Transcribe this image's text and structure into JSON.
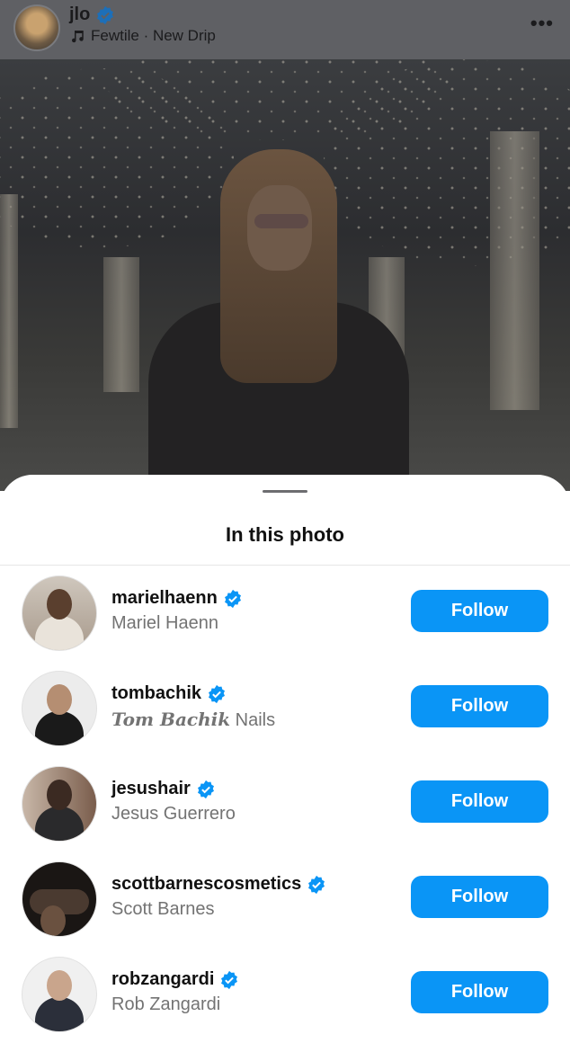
{
  "post": {
    "username": "jlo",
    "music": "Fewtile · New Drip",
    "more_label": "•••"
  },
  "sheet": {
    "title": "In this photo"
  },
  "people": [
    {
      "username": "marielhaenn",
      "name": "Mariel Haenn",
      "name_styled": "",
      "follow_label": "Follow"
    },
    {
      "username": "tombachik",
      "name": "Nails",
      "name_styled": "Tom Bachik",
      "follow_label": "Follow"
    },
    {
      "username": "jesushair",
      "name": "Jesus Guerrero",
      "name_styled": "",
      "follow_label": "Follow"
    },
    {
      "username": "scottbarnescosmetics",
      "name": "Scott Barnes",
      "name_styled": "",
      "follow_label": "Follow"
    },
    {
      "username": "robzangardi",
      "name": "Rob Zangardi",
      "name_styled": "",
      "follow_label": "Follow"
    }
  ],
  "colors": {
    "accent": "#0a95f6",
    "verified": "#0a95f6"
  },
  "icons": {
    "verified": "verified-badge-icon",
    "music": "music-note-icon",
    "more": "more-options-icon"
  }
}
